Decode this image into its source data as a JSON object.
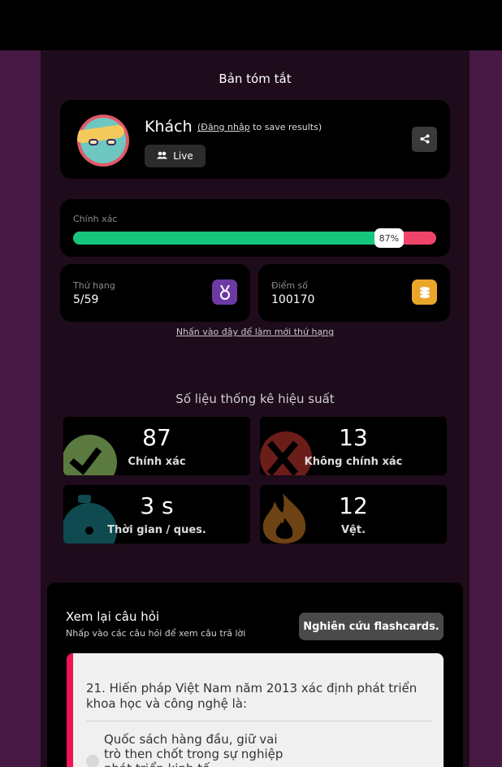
{
  "summary": {
    "title": "Bản tóm tắt",
    "guest_name": "Khách",
    "login_link": "(Đăng nhập",
    "login_suffix": " to save results)",
    "live_label": "Live"
  },
  "accuracy": {
    "label": "Chính xác",
    "percent": 87,
    "percent_label": "87%",
    "colors": {
      "correct": "#17c67d",
      "incorrect": "#f0456b"
    }
  },
  "rank": {
    "label": "Thứ hạng",
    "value": "5/59",
    "icon": "medal-icon",
    "color": "#6d3aa3"
  },
  "score": {
    "label": "Điểm số",
    "value": "100170",
    "icon": "coins-icon",
    "color": "#e9a72a"
  },
  "refresh_link": "Nhấn vào đây để làm mới thứ hạng",
  "performance": {
    "title": "Số liệu thống kê hiệu suất",
    "stats": [
      {
        "value": "87",
        "label": "Chính xác",
        "icon": "checkmark-icon",
        "color": "#5a7a3f"
      },
      {
        "value": "13",
        "label": "Không chính xác",
        "icon": "cross-icon",
        "color": "#6b1d1a"
      },
      {
        "value": "3 s",
        "label": "Thời gian / ques.",
        "icon": "stopwatch-icon",
        "color": "#0e4a4f"
      },
      {
        "value": "12",
        "label": "Vệt.",
        "icon": "fire-icon",
        "color": "#6e4314"
      }
    ]
  },
  "review": {
    "title": "Xem lại câu hỏi",
    "subtitle": "Nhấp vào các câu hỏi để xem câu trả lời",
    "flashcards_button": "Nghiên cứu flashcards.",
    "question": {
      "number_text": "21.   Hiến pháp Việt Nam năm 2013 xác định phát triển khoa học và công nghệ là:",
      "option_1": "Quốc sách hàng đầu, giữ vai trò then chốt trong sự nghiệp phát triển kinh tế -"
    }
  }
}
